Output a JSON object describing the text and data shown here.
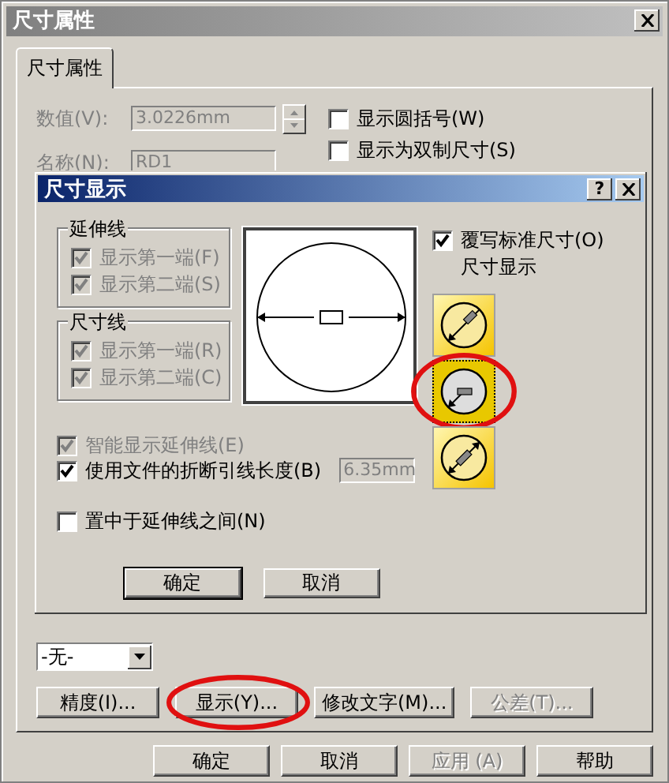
{
  "window": {
    "title": "尺寸属性"
  },
  "tabs": [
    {
      "label": "尺寸属性",
      "selected": true
    }
  ],
  "fields": [
    {
      "label": "数值(V):",
      "value": "3.0226mm",
      "disabled": true,
      "spinner": true
    },
    {
      "label": "名称(N):",
      "value": "RD1",
      "disabled": true,
      "spinner": false
    }
  ],
  "options": [
    {
      "label": "显示圆括号(W)",
      "checked": false
    },
    {
      "label": "显示为双制尺寸(S)",
      "checked": false
    }
  ],
  "dialog": {
    "title": "尺寸显示",
    "help": "?",
    "groups": [
      {
        "title": "延伸线",
        "items": [
          {
            "label": "显示第一端(F)",
            "checked": true,
            "disabled": true
          },
          {
            "label": "显示第二端(S)",
            "checked": true,
            "disabled": true
          }
        ]
      },
      {
        "title": "尺寸线",
        "items": [
          {
            "label": "显示第一端(R)",
            "checked": true,
            "disabled": true
          },
          {
            "label": "显示第二端(C)",
            "checked": true,
            "disabled": true
          }
        ]
      }
    ],
    "override": {
      "label": "覆写标准尺寸(O)",
      "checked": true
    },
    "display_label": "尺寸显示",
    "display_styles": [
      {
        "kind": "outside",
        "selected": false,
        "circled": false
      },
      {
        "kind": "radius",
        "selected": true,
        "circled": true
      },
      {
        "kind": "inside",
        "selected": false,
        "circled": false
      }
    ],
    "smart": {
      "label": "智能显示延伸线(E)",
      "checked": true,
      "disabled": true
    },
    "break_length": {
      "label": "使用文件的折断引线长度(B)",
      "checked": true,
      "value": "6.35mm"
    },
    "center": {
      "label": "置中于延伸线之间(N)",
      "checked": false
    },
    "buttons": [
      {
        "label": "确定",
        "default": true
      },
      {
        "label": "取消",
        "default": false
      }
    ]
  },
  "dropdown": {
    "value": "-无-"
  },
  "action_buttons": [
    {
      "label": "精度(I)...",
      "disabled": false,
      "circled": false
    },
    {
      "label": "显示(Y)...",
      "disabled": false,
      "circled": true
    },
    {
      "label": "修改文字(M)...",
      "disabled": false,
      "circled": false
    },
    {
      "label": "公差(T)...",
      "disabled": true,
      "circled": false
    }
  ],
  "footer_buttons": [
    {
      "label": "确定",
      "disabled": false
    },
    {
      "label": "取消",
      "disabled": false
    },
    {
      "label": "应用 (A)",
      "disabled": true
    },
    {
      "label": "帮助",
      "disabled": false
    }
  ]
}
